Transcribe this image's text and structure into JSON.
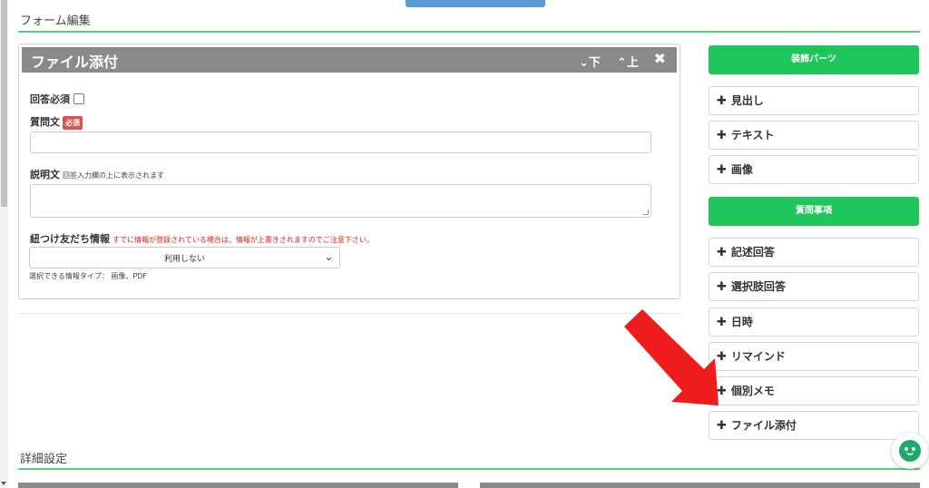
{
  "section": {
    "form_edit": "フォーム編集",
    "detail_settings": "詳細設定"
  },
  "card": {
    "title": "ファイル添付",
    "down_label": "下",
    "up_label": "上",
    "required_answer_label": "回答必須",
    "question_label": "質問文",
    "required_badge": "必須",
    "description_label": "説明文",
    "description_hint": "回答入力欄の上に表示されます",
    "link_label": "紐つけ友だち情報",
    "link_warning": "すでに情報が登録されている場合は、情報が上書きされますのでご注意下さい。",
    "link_select_value": "利用しない",
    "info_types": "選択できる情報タイプ： 画像、PDF"
  },
  "sidebar": {
    "decoration_header": "装飾パーツ",
    "decoration_items": [
      "見出し",
      "テキスト",
      "画像"
    ],
    "question_header": "質問事項",
    "question_items": [
      "記述回答",
      "選択肢回答",
      "日時",
      "リマインド",
      "個別メモ",
      "ファイル添付"
    ]
  },
  "colors": {
    "accent_green": "#1ec65b",
    "arrow_red": "#ee1c1c",
    "header_gray": "#8a8a8a"
  },
  "icons": [
    "plus-icon",
    "close-icon",
    "chevron-down-icon",
    "chevron-up-icon",
    "chat-support-icon",
    "pointer-arrow-icon"
  ]
}
